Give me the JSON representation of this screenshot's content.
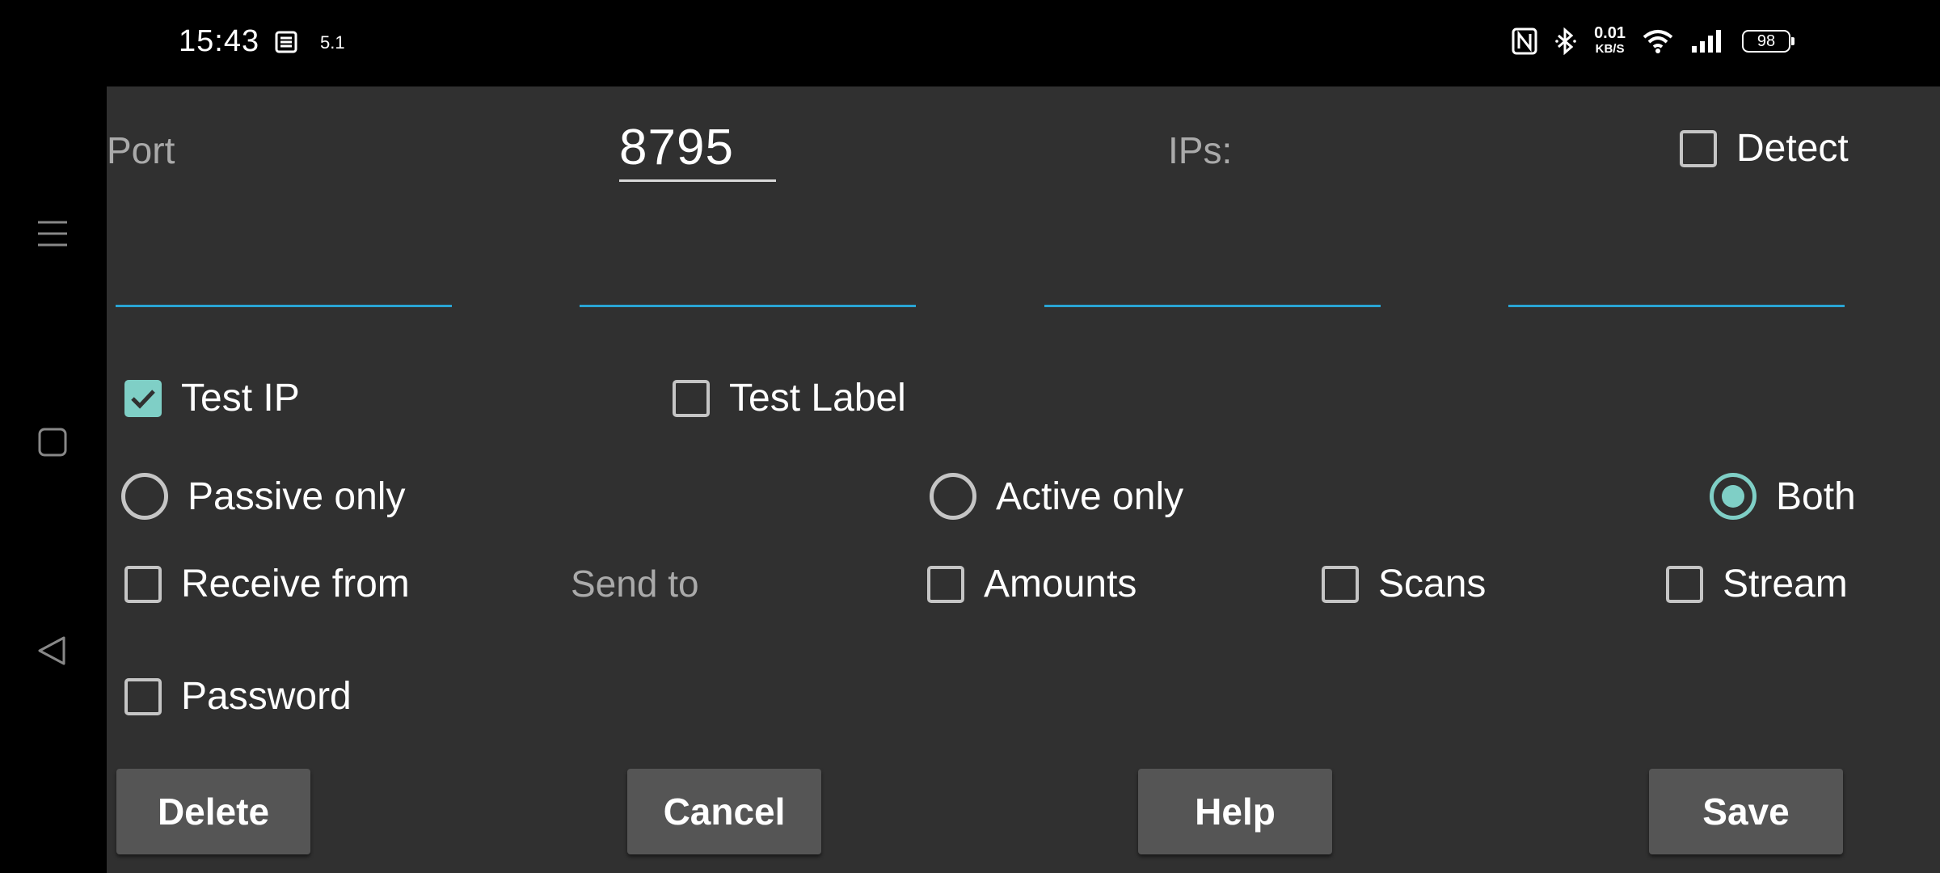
{
  "status_bar": {
    "time": "15:43",
    "small_text": "5.1",
    "speed_value": "0.01",
    "speed_unit": "KB/S",
    "battery": "98",
    "icons": [
      "notification-icon",
      "nfc-icon",
      "bluetooth-icon",
      "wifi-icon",
      "signal-icon",
      "battery-icon"
    ]
  },
  "nav_bar": {
    "icons": [
      "menu-icon",
      "home-icon",
      "back-icon"
    ]
  },
  "form": {
    "port_label": "Port",
    "port_value": "8795",
    "ips_label": "IPs:",
    "detect_label": "Detect",
    "detect_checked": false,
    "ip_fields": [
      "",
      "",
      "",
      ""
    ],
    "test_ip_label": "Test IP",
    "test_ip_checked": true,
    "test_label_label": "Test Label",
    "test_label_checked": false,
    "mode_options": [
      "Passive only",
      "Active only",
      "Both"
    ],
    "mode_selected": "Both",
    "receive_from_label": "Receive from",
    "send_to_label": "Send to",
    "amounts_label": "Amounts",
    "scans_label": "Scans",
    "stream_label": "Stream",
    "password_label": "Password"
  },
  "buttons": {
    "delete": "Delete",
    "cancel": "Cancel",
    "help": "Help",
    "save": "Save"
  },
  "colors": {
    "panel_bg": "#303030",
    "accent": "#7fcfc6",
    "field_underline": "#29a4d4",
    "button_bg": "#555555"
  }
}
